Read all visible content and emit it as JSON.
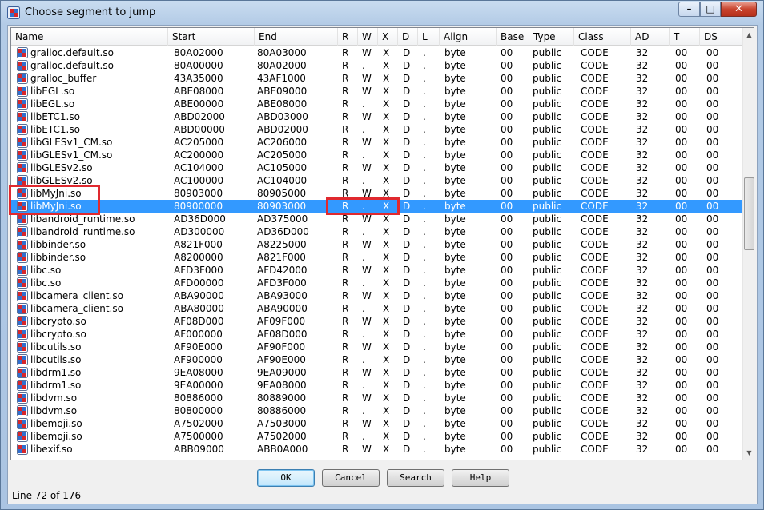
{
  "window": {
    "title": "Choose segment to jump",
    "minimize": "–",
    "maximize": "□",
    "close": "✕"
  },
  "columns": [
    "Name",
    "Start",
    "End",
    "R",
    "W",
    "X",
    "D",
    "L",
    "Align",
    "Base",
    "Type",
    "Class",
    "AD",
    "T",
    "DS"
  ],
  "sort_indicator": "˄",
  "rows": [
    [
      "gralloc.default.so",
      "80A02000",
      "80A03000",
      "R",
      "W",
      "X",
      "D",
      ".",
      "byte",
      "00",
      "public",
      "CODE",
      "32",
      "00",
      "00"
    ],
    [
      "gralloc.default.so",
      "80A00000",
      "80A02000",
      "R",
      ".",
      "X",
      "D",
      ".",
      "byte",
      "00",
      "public",
      "CODE",
      "32",
      "00",
      "00"
    ],
    [
      "gralloc_buffer",
      "43A35000",
      "43AF1000",
      "R",
      "W",
      "X",
      "D",
      ".",
      "byte",
      "00",
      "public",
      "CODE",
      "32",
      "00",
      "00"
    ],
    [
      "libEGL.so",
      "ABE08000",
      "ABE09000",
      "R",
      "W",
      "X",
      "D",
      ".",
      "byte",
      "00",
      "public",
      "CODE",
      "32",
      "00",
      "00"
    ],
    [
      "libEGL.so",
      "ABE00000",
      "ABE08000",
      "R",
      ".",
      "X",
      "D",
      ".",
      "byte",
      "00",
      "public",
      "CODE",
      "32",
      "00",
      "00"
    ],
    [
      "libETC1.so",
      "ABD02000",
      "ABD03000",
      "R",
      "W",
      "X",
      "D",
      ".",
      "byte",
      "00",
      "public",
      "CODE",
      "32",
      "00",
      "00"
    ],
    [
      "libETC1.so",
      "ABD00000",
      "ABD02000",
      "R",
      ".",
      "X",
      "D",
      ".",
      "byte",
      "00",
      "public",
      "CODE",
      "32",
      "00",
      "00"
    ],
    [
      "libGLESv1_CM.so",
      "AC205000",
      "AC206000",
      "R",
      "W",
      "X",
      "D",
      ".",
      "byte",
      "00",
      "public",
      "CODE",
      "32",
      "00",
      "00"
    ],
    [
      "libGLESv1_CM.so",
      "AC200000",
      "AC205000",
      "R",
      ".",
      "X",
      "D",
      ".",
      "byte",
      "00",
      "public",
      "CODE",
      "32",
      "00",
      "00"
    ],
    [
      "libGLESv2.so",
      "AC104000",
      "AC105000",
      "R",
      "W",
      "X",
      "D",
      ".",
      "byte",
      "00",
      "public",
      "CODE",
      "32",
      "00",
      "00"
    ],
    [
      "libGLESv2.so",
      "AC100000",
      "AC104000",
      "R",
      ".",
      "X",
      "D",
      ".",
      "byte",
      "00",
      "public",
      "CODE",
      "32",
      "00",
      "00"
    ],
    [
      "libMyJni.so",
      "80903000",
      "80905000",
      "R",
      "W",
      "X",
      "D",
      ".",
      "byte",
      "00",
      "public",
      "CODE",
      "32",
      "00",
      "00"
    ],
    [
      "libMyJni.so",
      "80900000",
      "80903000",
      "R",
      ".",
      "X",
      "D",
      ".",
      "byte",
      "00",
      "public",
      "CODE",
      "32",
      "00",
      "00"
    ],
    [
      "libandroid_runtime.so",
      "AD36D000",
      "AD375000",
      "R",
      "W",
      "X",
      "D",
      ".",
      "byte",
      "00",
      "public",
      "CODE",
      "32",
      "00",
      "00"
    ],
    [
      "libandroid_runtime.so",
      "AD300000",
      "AD36D000",
      "R",
      ".",
      "X",
      "D",
      ".",
      "byte",
      "00",
      "public",
      "CODE",
      "32",
      "00",
      "00"
    ],
    [
      "libbinder.so",
      "A821F000",
      "A8225000",
      "R",
      "W",
      "X",
      "D",
      ".",
      "byte",
      "00",
      "public",
      "CODE",
      "32",
      "00",
      "00"
    ],
    [
      "libbinder.so",
      "A8200000",
      "A821F000",
      "R",
      ".",
      "X",
      "D",
      ".",
      "byte",
      "00",
      "public",
      "CODE",
      "32",
      "00",
      "00"
    ],
    [
      "libc.so",
      "AFD3F000",
      "AFD42000",
      "R",
      "W",
      "X",
      "D",
      ".",
      "byte",
      "00",
      "public",
      "CODE",
      "32",
      "00",
      "00"
    ],
    [
      "libc.so",
      "AFD00000",
      "AFD3F000",
      "R",
      ".",
      "X",
      "D",
      ".",
      "byte",
      "00",
      "public",
      "CODE",
      "32",
      "00",
      "00"
    ],
    [
      "libcamera_client.so",
      "ABA90000",
      "ABA93000",
      "R",
      "W",
      "X",
      "D",
      ".",
      "byte",
      "00",
      "public",
      "CODE",
      "32",
      "00",
      "00"
    ],
    [
      "libcamera_client.so",
      "ABA80000",
      "ABA90000",
      "R",
      ".",
      "X",
      "D",
      ".",
      "byte",
      "00",
      "public",
      "CODE",
      "32",
      "00",
      "00"
    ],
    [
      "libcrypto.so",
      "AF08D000",
      "AF09F000",
      "R",
      "W",
      "X",
      "D",
      ".",
      "byte",
      "00",
      "public",
      "CODE",
      "32",
      "00",
      "00"
    ],
    [
      "libcrypto.so",
      "AF000000",
      "AF08D000",
      "R",
      ".",
      "X",
      "D",
      ".",
      "byte",
      "00",
      "public",
      "CODE",
      "32",
      "00",
      "00"
    ],
    [
      "libcutils.so",
      "AF90E000",
      "AF90F000",
      "R",
      "W",
      "X",
      "D",
      ".",
      "byte",
      "00",
      "public",
      "CODE",
      "32",
      "00",
      "00"
    ],
    [
      "libcutils.so",
      "AF900000",
      "AF90E000",
      "R",
      ".",
      "X",
      "D",
      ".",
      "byte",
      "00",
      "public",
      "CODE",
      "32",
      "00",
      "00"
    ],
    [
      "libdrm1.so",
      "9EA08000",
      "9EA09000",
      "R",
      "W",
      "X",
      "D",
      ".",
      "byte",
      "00",
      "public",
      "CODE",
      "32",
      "00",
      "00"
    ],
    [
      "libdrm1.so",
      "9EA00000",
      "9EA08000",
      "R",
      ".",
      "X",
      "D",
      ".",
      "byte",
      "00",
      "public",
      "CODE",
      "32",
      "00",
      "00"
    ],
    [
      "libdvm.so",
      "80886000",
      "80889000",
      "R",
      "W",
      "X",
      "D",
      ".",
      "byte",
      "00",
      "public",
      "CODE",
      "32",
      "00",
      "00"
    ],
    [
      "libdvm.so",
      "80800000",
      "80886000",
      "R",
      ".",
      "X",
      "D",
      ".",
      "byte",
      "00",
      "public",
      "CODE",
      "32",
      "00",
      "00"
    ],
    [
      "libemoji.so",
      "A7502000",
      "A7503000",
      "R",
      "W",
      "X",
      "D",
      ".",
      "byte",
      "00",
      "public",
      "CODE",
      "32",
      "00",
      "00"
    ],
    [
      "libemoji.so",
      "A7500000",
      "A7502000",
      "R",
      ".",
      "X",
      "D",
      ".",
      "byte",
      "00",
      "public",
      "CODE",
      "32",
      "00",
      "00"
    ],
    [
      "libexif.so",
      "ABB09000",
      "ABB0A000",
      "R",
      "W",
      "X",
      "D",
      ".",
      "byte",
      "00",
      "public",
      "CODE",
      "32",
      "00",
      "00"
    ]
  ],
  "selected_row": 12,
  "buttons": {
    "ok": "OK",
    "cancel": "Cancel",
    "search": "Search",
    "help": "Help"
  },
  "status": "Line 72 of 176",
  "colors": {
    "selection": "#3399ff",
    "highlight_box": "#e0292f",
    "icon_red": "#d7262b",
    "icon_blue": "#2f6fd0"
  }
}
